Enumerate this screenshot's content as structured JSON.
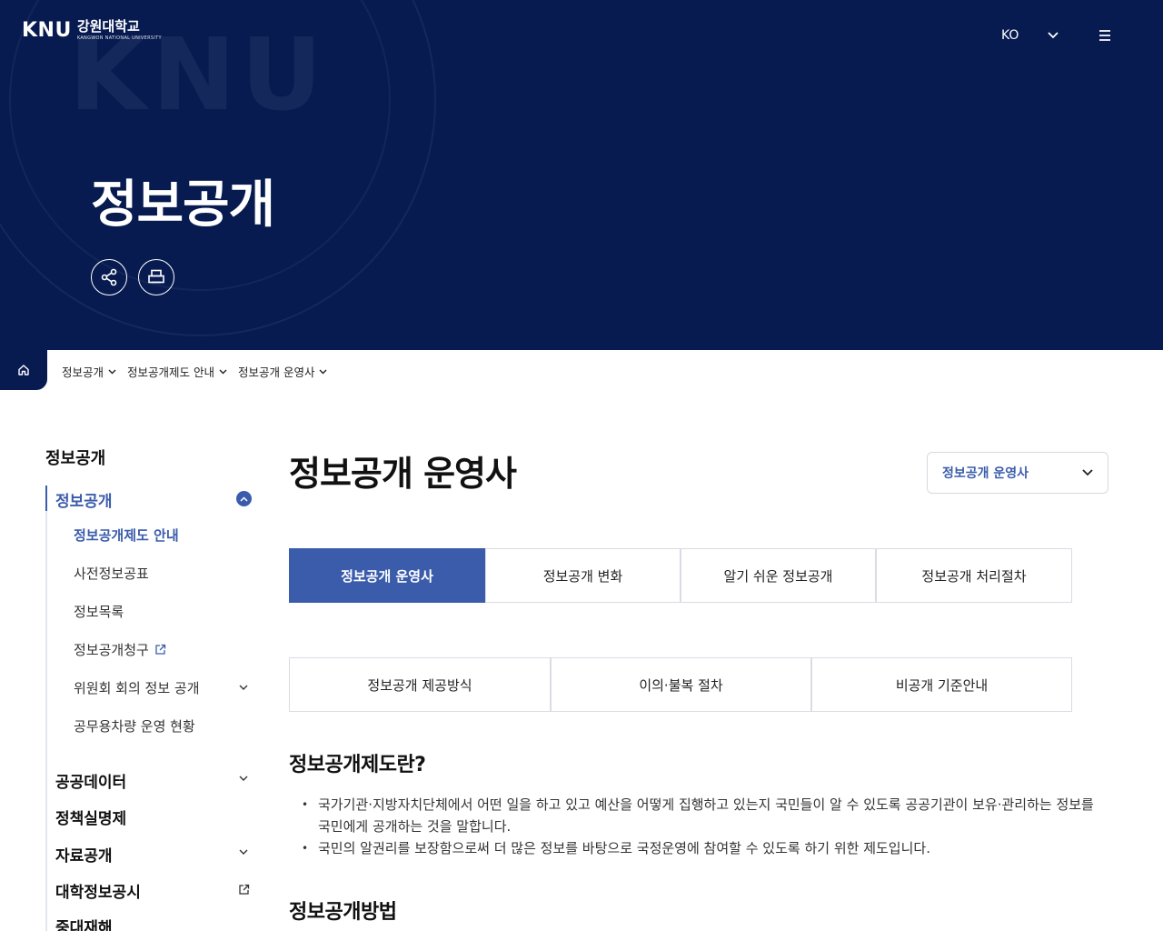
{
  "header": {
    "logo_mark": "KNU",
    "logo_kor": "강원대학교",
    "logo_eng": "KANGWON NATIONAL UNIVERSITY",
    "lang": "KO",
    "hero_title": "정보공개",
    "watermark": "KNU"
  },
  "breadcrumb": {
    "items": [
      "정보공개",
      "정보공개제도 안내",
      "정보공개 운영사"
    ]
  },
  "sidebar": {
    "title": "정보공개",
    "items": [
      {
        "label": "정보공개"
      },
      {
        "label": "공공데이터"
      },
      {
        "label": "정책실명제"
      },
      {
        "label": "자료공개"
      },
      {
        "label": "대학정보공시"
      },
      {
        "label": "중대재해"
      }
    ],
    "sub_items": [
      {
        "label": "정보공개제도 안내"
      },
      {
        "label": "사전정보공표"
      },
      {
        "label": "정보목록"
      },
      {
        "label": "정보공개청구"
      },
      {
        "label": "위원회 회의 정보 공개"
      },
      {
        "label": "공무용차량 운영 현황"
      }
    ]
  },
  "main": {
    "page_title": "정보공개 운영사",
    "select_value": "정보공개 운영사",
    "tabs_row1": [
      "정보공개 운영사",
      "정보공개 변화",
      "알기 쉬운 정보공개",
      "정보공개 처리절차"
    ],
    "tabs_row2": [
      "정보공개 제공방식",
      "이의·불복 절차",
      "비공개 기준안내"
    ],
    "section1_title": "정보공개제도란?",
    "section1_bullets": [
      "국가기관·지방자치단체에서 어떤 일을 하고 있고 예산을 어떻게 집행하고 있는지 국민들이 알 수 있도록 공공기관이 보유·관리하는 정보를 국민에게 공개하는 것을 말합니다.",
      "국민의 알권리를 보장함으로써 더 많은 정보를 바탕으로 국정운영에 참여할 수 있도록 하기 위한 제도입니다."
    ],
    "section2_title": "정보공개방법"
  },
  "colors": {
    "navy": "#071b51",
    "accent": "#3a5cab"
  }
}
